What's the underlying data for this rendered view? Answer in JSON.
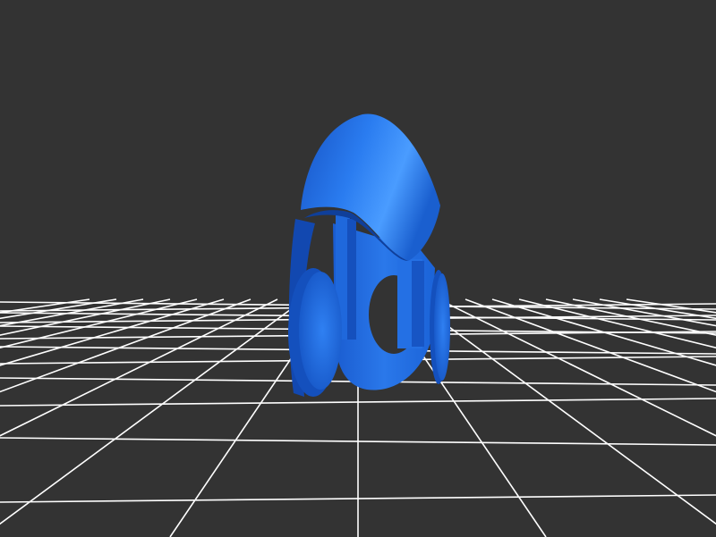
{
  "viewer": {
    "background_color": "#333333",
    "grid_color": "#ffffff",
    "model_color": "#1e6fe0",
    "model_highlight": "#3a8cf5",
    "model_shadow": "#0c3f9a",
    "grid_visible": true
  }
}
